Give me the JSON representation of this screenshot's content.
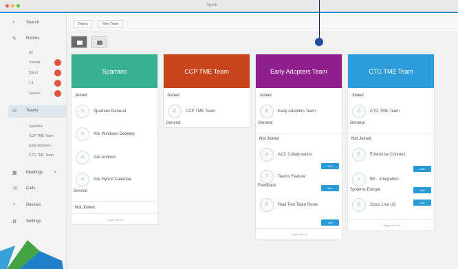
{
  "window": {
    "title": "Spark"
  },
  "sidebar": {
    "search": "Search",
    "rooms": "Rooms",
    "rooms_sub": [
      "All",
      "Unread",
      "Direct",
      "1:1",
      "Spaces"
    ],
    "teams": "Teams",
    "teams_sub": [
      "Spartans",
      "CCP TME Team",
      "Early Adopters",
      "CTG TME Team"
    ],
    "meetings": "Meetings",
    "calls": "Calls",
    "devices": "Devices",
    "settings": "Settings"
  },
  "tabs": [
    "Teams",
    "New Team"
  ],
  "cards": [
    {
      "title": "Spartans",
      "color": "#38b092",
      "joined_label": "Joined",
      "joined": [
        {
          "initial": "S",
          "name": "Spartans General",
          "sub": ""
        },
        {
          "initial": "A",
          "name": "Ask Windows Desktop",
          "sub": ""
        },
        {
          "initial": "A",
          "name": "Ask Android",
          "sub": ""
        },
        {
          "initial": "A",
          "name": "Ask Hybrid Calendar",
          "sub": "Service"
        }
      ],
      "notjoined_label": "Not Joined",
      "toggle_text": "Toggle this list"
    },
    {
      "title": "CCP TME Team",
      "color": "#c8441d",
      "joined_label": "Joined",
      "joined": [
        {
          "initial": "C",
          "name": "CCP TME Team",
          "sub": "General"
        }
      ]
    },
    {
      "title": "Early Adopters Team",
      "color": "#8e1f8d",
      "joined_label": "Joined",
      "joined": [
        {
          "initial": "E",
          "name": "Early Adopters Team",
          "sub": "General"
        }
      ],
      "notjoined_label": "Not Joined",
      "notjoined": [
        {
          "initial": "A",
          "name": "ACC Collaboration",
          "sub": "",
          "join": "Join"
        },
        {
          "initial": "T",
          "name": "Teams Feature",
          "sub": "Feedback",
          "join": "Join"
        },
        {
          "initial": "R",
          "name": "Real Test Team Room",
          "sub": "",
          "join": "Join"
        }
      ],
      "toggle_text": "Toggle this list"
    },
    {
      "title": "CTG TME Team",
      "color": "#2d9cdb",
      "joined_label": "Joined",
      "joined": [
        {
          "initial": "C",
          "name": "CTG TME Team",
          "sub": "General"
        }
      ],
      "notjoined_label": "Not Joined",
      "notjoined": [
        {
          "initial": "E",
          "name": "Enterprise Connect",
          "sub": "",
          "join": "Join"
        },
        {
          "initial": "I",
          "name": "BE - Integration",
          "sub": "Systems Europe",
          "join": "Join"
        },
        {
          "initial": "C",
          "name": "Cisco Live US",
          "sub": "",
          "join": "Join"
        }
      ],
      "toggle_text": "Toggle this list"
    }
  ]
}
